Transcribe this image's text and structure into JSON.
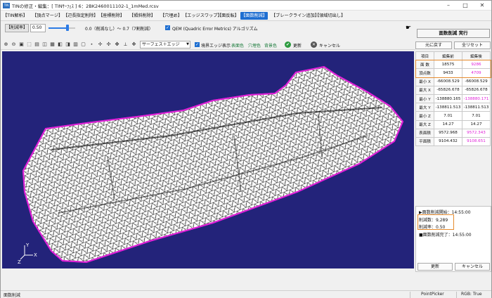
{
  "window": {
    "title": "TINの修正・編集：[ TINｻｰﾌｪｽ ] 6：2BK2460011102-1_1mMed.rcsv",
    "app_icon": "app-icon"
  },
  "menu": [
    {
      "label": "【TIN解析】",
      "active": false
    },
    {
      "label": "【頂点マージ】",
      "active": false
    },
    {
      "label": "【辺長指定削除】",
      "active": false
    },
    {
      "label": "【座標削除】",
      "active": false
    },
    {
      "label": "【傾斜削除】",
      "active": false
    },
    {
      "label": "【穴埋め】",
      "active": false
    },
    {
      "label": "【エッジスワップ】",
      "active": false
    },
    {
      "label": "【面反転】",
      "active": false
    },
    {
      "label": "【面数削減】",
      "active": true
    },
    {
      "label": "【ブレークライン追加】",
      "active": false
    },
    {
      "label": "【領域切出し】",
      "active": false
    }
  ],
  "options": {
    "reduction_label": "【削減率】",
    "reduction_value": "0.50",
    "slider_level": 0.7,
    "range_text": "0.0（削減なし）～ 0.7（7割削減）",
    "qem_label": "QEM (Quadric Error Metrics) アルゴリズム",
    "qem_checked": true,
    "execute_label": "面数削減 実行"
  },
  "toolbar": {
    "display_mode": "サーフェス＋エッジ",
    "boundary_edge_label": "境界エッジ表示",
    "boundary_edge_checked": true,
    "surface_color_label": "表面色",
    "hole_color_label": "穴埋色",
    "bg_color_label": "背景色",
    "refresh_label": "更新",
    "cancel_label": "キャンセル"
  },
  "panel": {
    "restore_label": "元に戻す",
    "reset_label": "全リセット",
    "headers": [
      "項目",
      "編集前",
      "編集後"
    ],
    "rows": [
      {
        "item": "面 数",
        "before": "18575",
        "after": "9286",
        "changed": true
      },
      {
        "item": "頂点数",
        "before": "9433",
        "after": "4709",
        "changed": true
      },
      {
        "item": "最小 X",
        "before": "-66008.529",
        "after": "-66008.529",
        "changed": false
      },
      {
        "item": "最大 X",
        "before": "-65826.678",
        "after": "-65826.678",
        "changed": false
      },
      {
        "item": "最小 Y",
        "before": "-138880.165",
        "after": "-138880.171",
        "changed": true
      },
      {
        "item": "最大 Y",
        "before": "-138811.513",
        "after": "-138811.513",
        "changed": false
      },
      {
        "item": "最小 Z",
        "before": "7.01",
        "after": "7.01",
        "changed": false
      },
      {
        "item": "最大 Z",
        "before": "14.27",
        "after": "14.27",
        "changed": false
      },
      {
        "item": "表面積",
        "before": "9572.968",
        "after": "9572.343",
        "changed": true
      },
      {
        "item": "平面積",
        "before": "9104.432",
        "after": "9108.651",
        "changed": true
      }
    ]
  },
  "log": {
    "lines": [
      "▶面数削減開始：14:55:00",
      "削減数：9,289",
      "削減率：0.50",
      "■面数削減完了：14:55:00"
    ],
    "update_label": "更新",
    "cancel_label": "キャンセル"
  },
  "statusbar": {
    "left": "面数削減",
    "picker": "PointPicker",
    "rgb": "RGB: True"
  },
  "axis": {
    "x": "X",
    "y": "Y",
    "z": "Z"
  },
  "colors": {
    "viewport_bg": "#23237a",
    "mesh_fill": "#ffffff",
    "mesh_edge": "#111111",
    "boundary": "#e021d8",
    "highlight": "#e58b2e",
    "accent": "#1f6fd1"
  }
}
